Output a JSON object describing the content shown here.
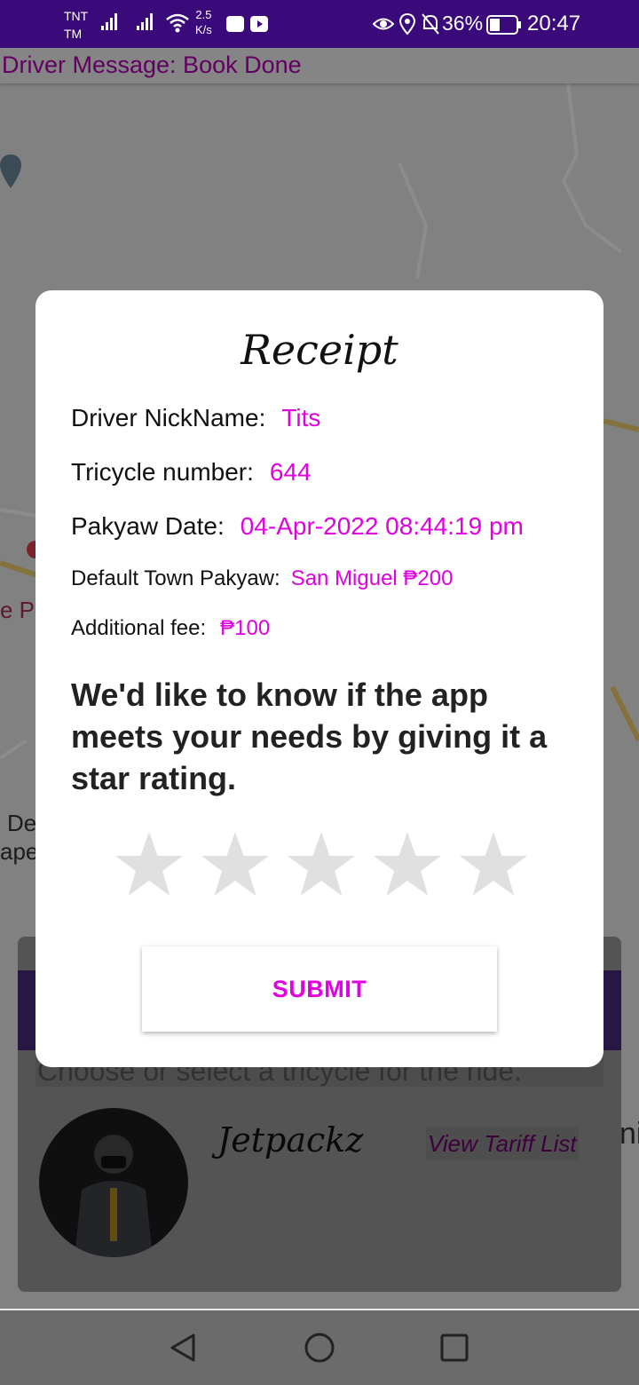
{
  "status_bar": {
    "carrier_line1": "TNT",
    "carrier_line2": "TM",
    "net_speed_value": "2.5",
    "net_speed_unit": "K/s",
    "battery": "36%",
    "time": "20:47"
  },
  "map": {
    "driver_message": "Driver Message: Book Done",
    "edge_label_1": "e P",
    "edge_label_2": "De",
    "edge_label_3": "apel"
  },
  "bottom_card": {
    "choose_text": "Choose or select a tricycle for the ride.",
    "driver_name": "Jetpackz",
    "tariff_link": "View Tariff List",
    "right_edge_text": "ni"
  },
  "dialog": {
    "title": "Receipt",
    "driver_nickname_label": "Driver NickName:",
    "driver_nickname_value": "Tits",
    "tricycle_number_label": "Tricycle number:",
    "tricycle_number_value": "644",
    "pakyaw_date_label": "Pakyaw Date:",
    "pakyaw_date_value": "04-Apr-2022 08:44:19 pm",
    "default_town_label": "Default Town Pakyaw:",
    "default_town_value": "San Miguel ₱200",
    "additional_fee_label": "Additional fee:",
    "additional_fee_value": "₱100",
    "rating_prompt": "We'd like to know if the app meets your needs by giving it a star rating.",
    "rating_value": 0,
    "rating_max": 5,
    "submit_label": "SUBMIT"
  },
  "colors": {
    "status_bar": "#3a0a7a",
    "accent_magenta": "#e000e0",
    "star_empty": "#e0e0e0"
  }
}
